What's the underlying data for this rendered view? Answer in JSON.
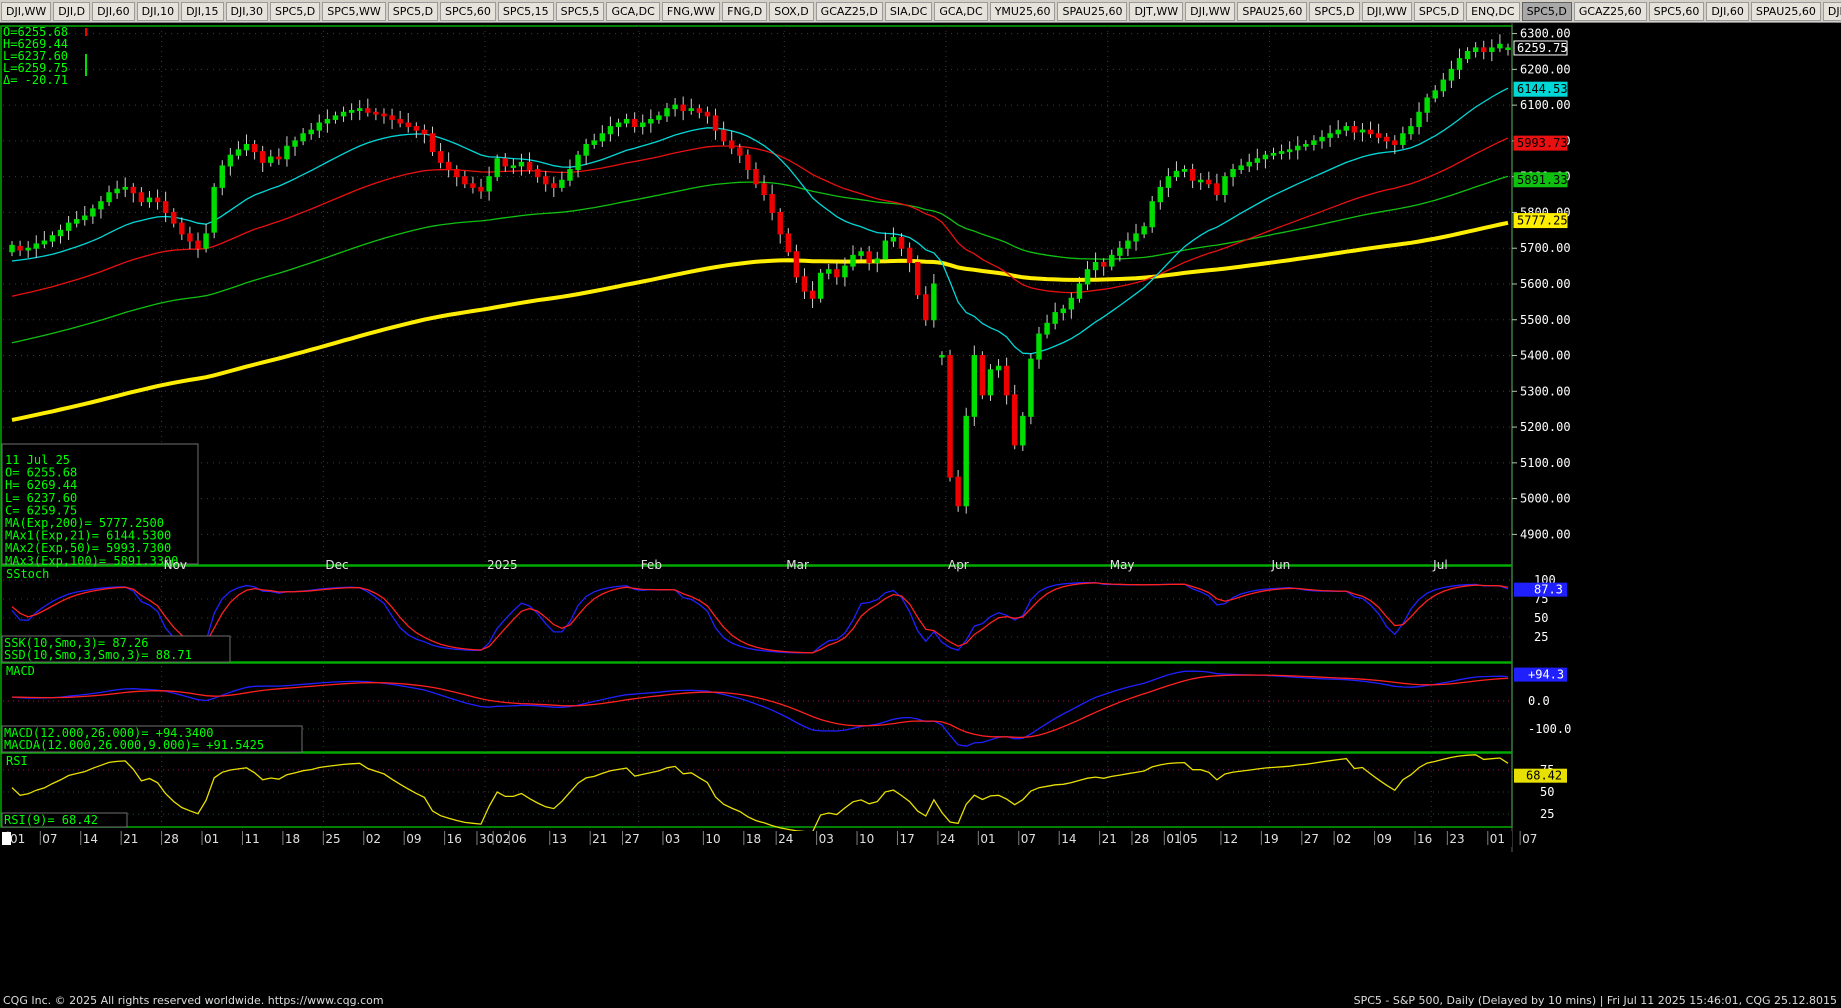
{
  "tabs": [
    "DJI,WW",
    "DJI,D",
    "DJI,60",
    "DJI,10",
    "DJI,15",
    "DJI,30",
    "SPC5,D",
    "SPC5,WW",
    "SPC5,D",
    "SPC5,60",
    "SPC5,15",
    "SPC5,5",
    "GCA,DC",
    "FNG,WW",
    "FNG,D",
    "SOX,D",
    "GCAZ25,D",
    "SIA,DC",
    "GCA,DC",
    "YMU25,60",
    "SPAU25,60",
    "DJT,WW",
    "DJI,WW",
    "SPAU25,60",
    "SPC5,D",
    "DJI,WW",
    "SPC5,D",
    "ENQ,DC",
    "SPC5,D",
    "GCAZ25,60",
    "SPC5,60",
    "DJI,60",
    "SPAU25,60",
    "DJI,MM",
    "+"
  ],
  "active_tab_index": 28,
  "footer": {
    "left": "CQG Inc. © 2025 All rights reserved worldwide. https://www.cqg.com",
    "right": "SPC5 - S&P 500, Daily (Delayed by 10 mins) | Fri Jul 11 2025 15:46:01, CQG 25.12.8015"
  },
  "colors": {
    "background": "#000000",
    "up": "#00dd00",
    "down": "#ee0000",
    "ema21": "#00d8d8",
    "ema50": "#e81010",
    "ema100": "#10c010",
    "ema200": "#ffee00",
    "panel_border": "#00aa00",
    "label_text": "#00ff00",
    "stoch_k": "#2020ff",
    "stoch_d": "#ff2020",
    "rsi": "#e8e000"
  },
  "top_readout": [
    "O=6255.68",
    "H=6269.44",
    "L=6237.60",
    "L=6259.75",
    "Δ= -20.71"
  ],
  "info_box": [
    "11 Jul 25",
    "O=               6255.68",
    "H=               6269.44",
    "L=               6237.60",
    "C=               6259.75",
    "MA(Exp,200)=    5777.2500",
    "MAx1(Exp,21)=   6144.5300",
    "MAx2(Exp,50)=   5993.7300",
    "MAx3(Exp,100)=  5891.3300"
  ],
  "stoch_label": "SStoch",
  "stoch_readout": [
    "SSK(10,Smo,3)=        87.26",
    "SSD(10,Smo,3,Smo,3)=   88.71"
  ],
  "macd_label": "MACD",
  "macd_readout": [
    "MACD(12.000,26.000)=          +94.3400",
    "MACDA(12.000,26.000,9.000)= +91.5425"
  ],
  "rsi_label": "RSI",
  "rsi_readout": "RSI(9)=    68.42",
  "chart_data": {
    "type": "candlestick",
    "title": "SPC5 - S&P 500, Daily",
    "price_axis": {
      "ticks": [
        "6300.00",
        "6200.00",
        "6100.00",
        "6000.00",
        "5900.00",
        "5800.00",
        "5700.00",
        "5600.00",
        "5500.00",
        "5400.00",
        "5300.00",
        "5200.00",
        "5100.00",
        "5000.00",
        "4900.00"
      ],
      "range": [
        4820,
        6310
      ]
    },
    "price_badges": [
      {
        "value": 6259.75,
        "text": "6259.75",
        "bg": "#000000",
        "fg": "#ffffff"
      },
      {
        "value": 6144.53,
        "text": "6144.53",
        "bg": "#00d8d8",
        "fg": "#000000"
      },
      {
        "value": 5993.73,
        "text": "5993.73",
        "bg": "#e81010",
        "fg": "#000000"
      },
      {
        "value": 5891.33,
        "text": "5891.33",
        "bg": "#10c010",
        "fg": "#000000"
      },
      {
        "value": 5777.25,
        "text": "5777.25",
        "bg": "#ffee00",
        "fg": "#000000"
      }
    ],
    "stoch_axis": {
      "ticks": [
        "100",
        "75",
        "50",
        "25"
      ],
      "badge": "87.3"
    },
    "macd_axis": {
      "ticks": [
        "0.0",
        "-100.0"
      ],
      "badge": "+94.3"
    },
    "rsi_axis": {
      "ticks": [
        "75",
        "50",
        "25"
      ],
      "badge": "68.42"
    },
    "month_labels": [
      {
        "i": 19,
        "text": "Nov"
      },
      {
        "i": 39,
        "text": "Dec"
      },
      {
        "i": 59,
        "text": "2025"
      },
      {
        "i": 78,
        "text": "Feb"
      },
      {
        "i": 96,
        "text": "Mar"
      },
      {
        "i": 116,
        "text": "Apr"
      },
      {
        "i": 136,
        "text": "May"
      },
      {
        "i": 156,
        "text": "Jun"
      },
      {
        "i": 176,
        "text": "Jul"
      }
    ],
    "day_labels": [
      {
        "i": 0,
        "text": "01"
      },
      {
        "i": 4,
        "text": "07"
      },
      {
        "i": 9,
        "text": "14"
      },
      {
        "i": 14,
        "text": "21"
      },
      {
        "i": 19,
        "text": "28"
      },
      {
        "i": 24,
        "text": "01"
      },
      {
        "i": 29,
        "text": "11"
      },
      {
        "i": 34,
        "text": "18"
      },
      {
        "i": 39,
        "text": "25"
      },
      {
        "i": 44,
        "text": "02"
      },
      {
        "i": 49,
        "text": "09"
      },
      {
        "i": 54,
        "text": "16"
      },
      {
        "i": 58,
        "text": "30"
      },
      {
        "i": 60,
        "text": "02"
      },
      {
        "i": 62,
        "text": "06"
      },
      {
        "i": 67,
        "text": "13"
      },
      {
        "i": 72,
        "text": "21"
      },
      {
        "i": 76,
        "text": "27"
      },
      {
        "i": 81,
        "text": "03"
      },
      {
        "i": 86,
        "text": "10"
      },
      {
        "i": 91,
        "text": "18"
      },
      {
        "i": 95,
        "text": "24"
      },
      {
        "i": 100,
        "text": "03"
      },
      {
        "i": 105,
        "text": "10"
      },
      {
        "i": 110,
        "text": "17"
      },
      {
        "i": 115,
        "text": "24"
      },
      {
        "i": 120,
        "text": "01"
      },
      {
        "i": 125,
        "text": "07"
      },
      {
        "i": 130,
        "text": "14"
      },
      {
        "i": 135,
        "text": "21"
      },
      {
        "i": 139,
        "text": "28"
      },
      {
        "i": 143,
        "text": "01"
      },
      {
        "i": 145,
        "text": "05"
      },
      {
        "i": 150,
        "text": "12"
      },
      {
        "i": 155,
        "text": "19"
      },
      {
        "i": 160,
        "text": "27"
      },
      {
        "i": 164,
        "text": "02"
      },
      {
        "i": 169,
        "text": "09"
      },
      {
        "i": 174,
        "text": "16"
      },
      {
        "i": 178,
        "text": "23"
      },
      {
        "i": 183,
        "text": "01"
      },
      {
        "i": 187,
        "text": "07"
      }
    ],
    "close": [
      5708,
      5695,
      5700,
      5712,
      5720,
      5735,
      5750,
      5770,
      5780,
      5790,
      5810,
      5830,
      5855,
      5865,
      5870,
      5855,
      5830,
      5840,
      5830,
      5800,
      5770,
      5740,
      5720,
      5700,
      5740,
      5870,
      5930,
      5960,
      5975,
      5990,
      5970,
      5940,
      5955,
      5950,
      5985,
      6000,
      6020,
      6030,
      6050,
      6060,
      6070,
      6080,
      6085,
      6090,
      6080,
      6075,
      6070,
      6060,
      6050,
      6040,
      6030,
      6020,
      5970,
      5940,
      5920,
      5900,
      5880,
      5870,
      5860,
      5900,
      5950,
      5930,
      5930,
      5940,
      5920,
      5900,
      5880,
      5870,
      5890,
      5920,
      5960,
      5990,
      6000,
      6020,
      6040,
      6050,
      6060,
      6040,
      6050,
      6060,
      6070,
      6090,
      6100,
      6085,
      6090,
      6080,
      6070,
      6030,
      6000,
      5980,
      5960,
      5920,
      5880,
      5850,
      5800,
      5740,
      5690,
      5620,
      5580,
      5560,
      5630,
      5640,
      5620,
      5650,
      5680,
      5690,
      5660,
      5670,
      5720,
      5730,
      5700,
      5660,
      5570,
      5500,
      5600,
      5400,
      5060,
      4980,
      5230,
      5400,
      5290,
      5360,
      5370,
      5290,
      5150,
      5230,
      5390,
      5460,
      5490,
      5520,
      5530,
      5560,
      5600,
      5640,
      5660,
      5650,
      5680,
      5700,
      5720,
      5740,
      5760,
      5830,
      5870,
      5900,
      5915,
      5920,
      5890,
      5890,
      5880,
      5850,
      5900,
      5920,
      5930,
      5940,
      5950,
      5960,
      5965,
      5970,
      5975,
      5985,
      5990,
      6000,
      6010,
      6020,
      6030,
      6040,
      6025,
      6030,
      6020,
      6010,
      6000,
      5990,
      6020,
      6040,
      6080,
      6120,
      6140,
      6170,
      6200,
      6230,
      6250,
      6260,
      6250,
      6260,
      6270,
      6259.75
    ],
    "open": [
      5690,
      5705,
      5695,
      5700,
      5712,
      5720,
      5735,
      5750,
      5770,
      5780,
      5790,
      5810,
      5830,
      5855,
      5865,
      5870,
      5855,
      5830,
      5840,
      5830,
      5800,
      5770,
      5740,
      5720,
      5700,
      5745,
      5870,
      5930,
      5960,
      5975,
      5990,
      5970,
      5940,
      5955,
      5950,
      5985,
      6000,
      6020,
      6030,
      6050,
      6060,
      6070,
      6080,
      6085,
      6090,
      6080,
      6075,
      6070,
      6060,
      6050,
      6040,
      6030,
      6020,
      5970,
      5940,
      5920,
      5900,
      5880,
      5870,
      5860,
      5900,
      5950,
      5930,
      5930,
      5940,
      5920,
      5900,
      5880,
      5870,
      5890,
      5920,
      5960,
      5990,
      6000,
      6020,
      6040,
      6050,
      6060,
      6040,
      6050,
      6060,
      6070,
      6090,
      6100,
      6085,
      6090,
      6080,
      6070,
      6030,
      6000,
      5980,
      5960,
      5920,
      5880,
      5850,
      5800,
      5740,
      5690,
      5620,
      5580,
      5560,
      5630,
      5640,
      5620,
      5650,
      5680,
      5690,
      5660,
      5670,
      5720,
      5730,
      5700,
      5660,
      5570,
      5500,
      5400,
      5400,
      5060,
      4980,
      5230,
      5400,
      5290,
      5360,
      5370,
      5290,
      5150,
      5230,
      5390,
      5460,
      5490,
      5520,
      5530,
      5560,
      5600,
      5640,
      5660,
      5650,
      5680,
      5700,
      5720,
      5740,
      5760,
      5830,
      5870,
      5900,
      5915,
      5920,
      5890,
      5890,
      5880,
      5850,
      5900,
      5920,
      5930,
      5940,
      5950,
      5960,
      5965,
      5970,
      5975,
      5985,
      5990,
      6000,
      6010,
      6020,
      6030,
      6040,
      6025,
      6030,
      6020,
      6010,
      6000,
      5990,
      6020,
      6040,
      6080,
      6120,
      6140,
      6170,
      6200,
      6230,
      6250,
      6260,
      6250,
      6260,
      6255.68
    ]
  }
}
